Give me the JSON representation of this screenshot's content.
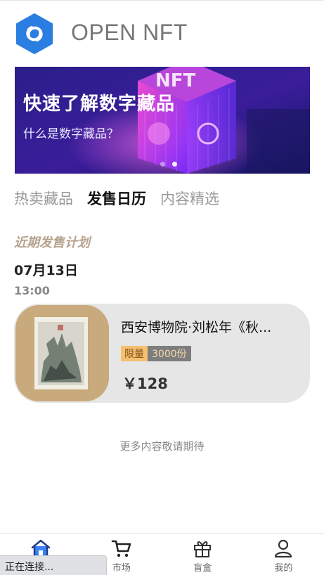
{
  "app": {
    "title": "OPEN NFT"
  },
  "banner": {
    "title": "快速了解数字藏品",
    "subtitle": "什么是数字藏品？",
    "dot_count": 2,
    "active_dot": 1
  },
  "tabs": [
    {
      "label": "热卖藏品",
      "active": false
    },
    {
      "label": "发售日历",
      "active": true
    },
    {
      "label": "内容精选",
      "active": false
    }
  ],
  "calendar": {
    "section_title": "近期发售计划",
    "date": "07月13日",
    "time": "13:00"
  },
  "product": {
    "title": "西安博物院·刘松年《秋...",
    "limit_label": "限量",
    "limit_value": "3000份",
    "price": "￥128"
  },
  "more_text": "更多内容敬请期待",
  "bottom_nav": [
    {
      "label": "首页",
      "icon": "home-icon",
      "active": true
    },
    {
      "label": "市场",
      "icon": "cart-icon",
      "active": false
    },
    {
      "label": "盲盒",
      "icon": "gift-icon",
      "active": false
    },
    {
      "label": "我的",
      "icon": "user-icon",
      "active": false
    }
  ],
  "status": {
    "text": "正在连接..."
  },
  "colors": {
    "accent_blue": "#2a7de1",
    "section_title": "#b7a28e",
    "badge_label_bg": "#f5c071",
    "badge_value_bg": "#7d7d7d"
  }
}
